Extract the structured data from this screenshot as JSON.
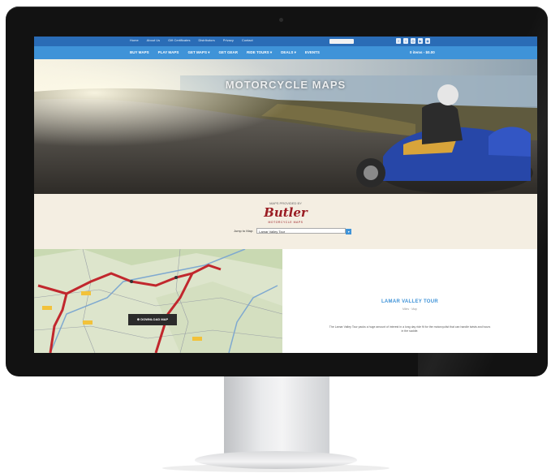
{
  "site": {
    "topbar": {
      "links": [
        "Home",
        "About Us",
        "Gift Certificates",
        "Distributors",
        "Privacy",
        "Contact"
      ],
      "social_icons": [
        "facebook-icon",
        "twitter-icon",
        "instagram-icon",
        "youtube-icon",
        "rss-icon"
      ]
    },
    "nav": {
      "items": [
        "BUY MAPS",
        "PLAY MAPS",
        "GET MAPS ▾",
        "GET GEAR",
        "RIDE TOURS ▾",
        "DEALS ▾",
        "EVENTS"
      ],
      "cart": "0 items - $0.00"
    },
    "hero": {
      "title": "MOTORCYCLE MAPS"
    },
    "brand": {
      "proudly": "MAPS PROVIDED BY",
      "logo": "Butler",
      "logo_sub": "MOTORCYCLE MAPS",
      "jump_label": "Jump to Map:",
      "jump_value": "Lamar Valley Tour",
      "jump_arrow": "▾"
    },
    "map": {
      "download_label": "⊕ DOWNLOAD MAP"
    },
    "tour": {
      "title": "LAMAR VALLEY TOUR",
      "meta": "Miles · Map",
      "description": "The Lamar Valley Tour packs a huge amount of interest in a long day ride fit for the motorcyclist that can handle twists and hours in the saddle."
    }
  },
  "colors": {
    "topbar": "#2a6cb6",
    "nav": "#3f93d8",
    "accent": "#3f93d8",
    "logo": "#9a1c23",
    "band": "#f4eee2",
    "bezel": "#121212"
  }
}
